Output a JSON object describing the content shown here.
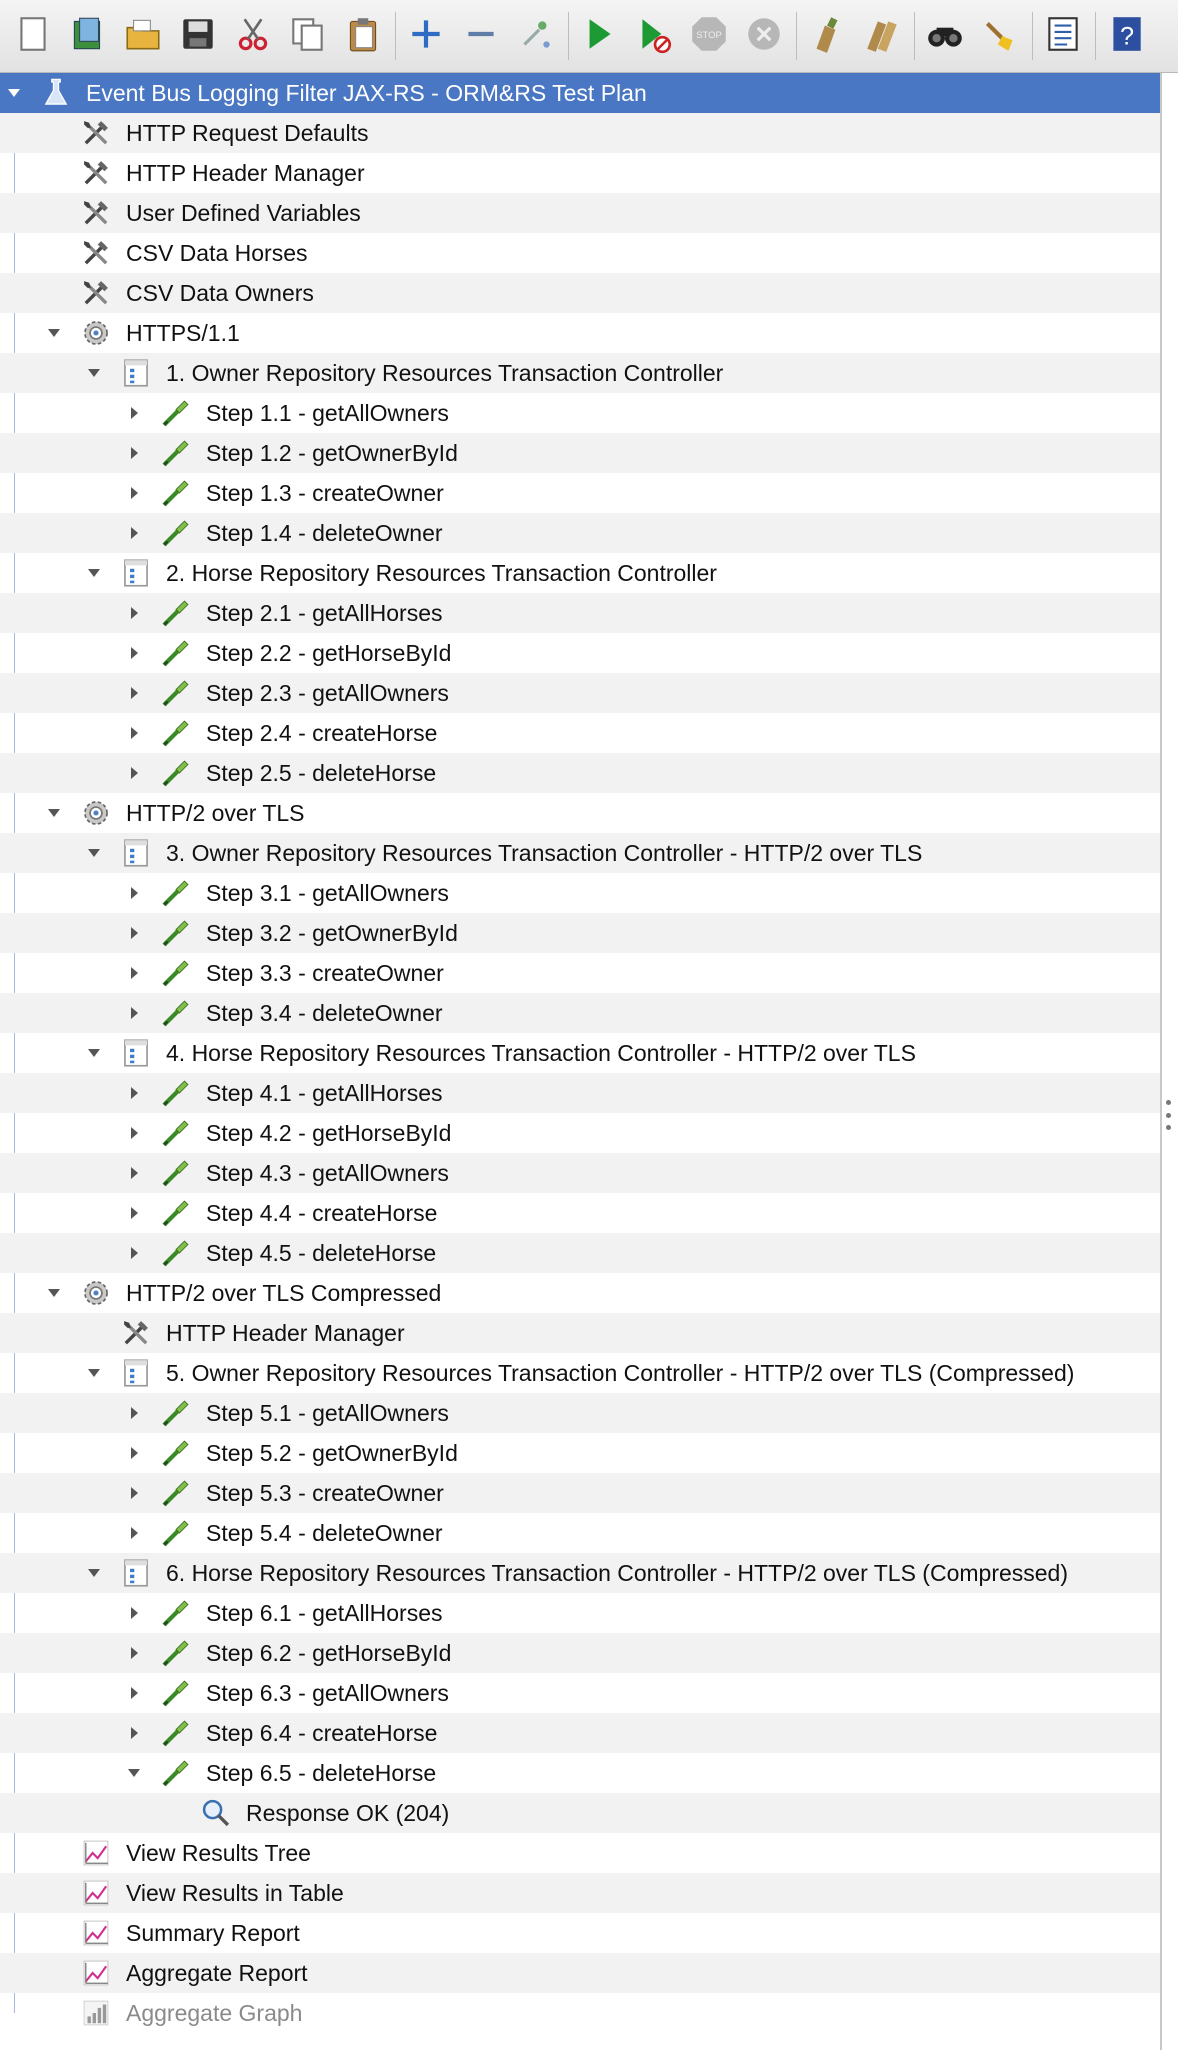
{
  "toolbar": {
    "buttons": [
      {
        "name": "new-icon"
      },
      {
        "name": "templates-icon"
      },
      {
        "name": "open-icon"
      },
      {
        "name": "save-icon"
      },
      {
        "name": "cut-icon"
      },
      {
        "name": "copy-icon"
      },
      {
        "name": "paste-icon"
      },
      {
        "name": "expand-icon"
      },
      {
        "name": "collapse-icon"
      },
      {
        "name": "toggle-icon"
      },
      {
        "name": "start-icon"
      },
      {
        "name": "start-no-pauses-icon"
      },
      {
        "name": "stop-icon"
      },
      {
        "name": "shutdown-icon"
      },
      {
        "name": "clear-icon"
      },
      {
        "name": "clear-all-icon"
      },
      {
        "name": "search-icon"
      },
      {
        "name": "reset-search-icon"
      },
      {
        "name": "function-helper-icon"
      },
      {
        "name": "help-icon"
      }
    ]
  },
  "tree": {
    "rows": [
      {
        "label": "Event Bus Logging Filter JAX-RS - ORM&RS Test Plan",
        "level": 0,
        "icon": "test-plan-icon",
        "toggle": "expanded",
        "selected": true
      },
      {
        "label": "HTTP Request Defaults",
        "level": 1,
        "icon": "config-element-icon",
        "toggle": "none"
      },
      {
        "label": "HTTP Header Manager",
        "level": 1,
        "icon": "config-element-icon",
        "toggle": "none"
      },
      {
        "label": "User Defined Variables",
        "level": 1,
        "icon": "config-element-icon",
        "toggle": "none"
      },
      {
        "label": "CSV Data Horses",
        "level": 1,
        "icon": "config-element-icon",
        "toggle": "none"
      },
      {
        "label": "CSV Data Owners",
        "level": 1,
        "icon": "config-element-icon",
        "toggle": "none"
      },
      {
        "label": "HTTPS/1.1",
        "level": 1,
        "icon": "thread-group-icon",
        "toggle": "expanded"
      },
      {
        "label": "1. Owner Repository Resources Transaction Controller",
        "level": 2,
        "icon": "transaction-controller-icon",
        "toggle": "expanded"
      },
      {
        "label": "Step 1.1 - getAllOwners",
        "level": 3,
        "icon": "sampler-icon",
        "toggle": "collapsed"
      },
      {
        "label": "Step 1.2 - getOwnerById",
        "level": 3,
        "icon": "sampler-icon",
        "toggle": "collapsed"
      },
      {
        "label": "Step 1.3 - createOwner",
        "level": 3,
        "icon": "sampler-icon",
        "toggle": "collapsed"
      },
      {
        "label": "Step 1.4 - deleteOwner",
        "level": 3,
        "icon": "sampler-icon",
        "toggle": "collapsed"
      },
      {
        "label": "2. Horse Repository Resources Transaction Controller",
        "level": 2,
        "icon": "transaction-controller-icon",
        "toggle": "expanded"
      },
      {
        "label": "Step 2.1 - getAllHorses",
        "level": 3,
        "icon": "sampler-icon",
        "toggle": "collapsed"
      },
      {
        "label": "Step 2.2 - getHorseById",
        "level": 3,
        "icon": "sampler-icon",
        "toggle": "collapsed"
      },
      {
        "label": "Step 2.3 - getAllOwners",
        "level": 3,
        "icon": "sampler-icon",
        "toggle": "collapsed"
      },
      {
        "label": "Step 2.4 - createHorse",
        "level": 3,
        "icon": "sampler-icon",
        "toggle": "collapsed"
      },
      {
        "label": "Step 2.5 - deleteHorse",
        "level": 3,
        "icon": "sampler-icon",
        "toggle": "collapsed"
      },
      {
        "label": "HTTP/2 over TLS",
        "level": 1,
        "icon": "thread-group-icon",
        "toggle": "expanded"
      },
      {
        "label": "3. Owner Repository Resources Transaction Controller - HTTP/2 over TLS",
        "level": 2,
        "icon": "transaction-controller-icon",
        "toggle": "expanded"
      },
      {
        "label": "Step 3.1 - getAllOwners",
        "level": 3,
        "icon": "sampler-icon",
        "toggle": "collapsed"
      },
      {
        "label": "Step 3.2 - getOwnerById",
        "level": 3,
        "icon": "sampler-icon",
        "toggle": "collapsed"
      },
      {
        "label": "Step 3.3 - createOwner",
        "level": 3,
        "icon": "sampler-icon",
        "toggle": "collapsed"
      },
      {
        "label": "Step 3.4 - deleteOwner",
        "level": 3,
        "icon": "sampler-icon",
        "toggle": "collapsed"
      },
      {
        "label": "4. Horse Repository Resources Transaction Controller - HTTP/2 over TLS",
        "level": 2,
        "icon": "transaction-controller-icon",
        "toggle": "expanded"
      },
      {
        "label": "Step 4.1 - getAllHorses",
        "level": 3,
        "icon": "sampler-icon",
        "toggle": "collapsed"
      },
      {
        "label": "Step 4.2 - getHorseById",
        "level": 3,
        "icon": "sampler-icon",
        "toggle": "collapsed"
      },
      {
        "label": "Step 4.3 - getAllOwners",
        "level": 3,
        "icon": "sampler-icon",
        "toggle": "collapsed"
      },
      {
        "label": "Step 4.4 - createHorse",
        "level": 3,
        "icon": "sampler-icon",
        "toggle": "collapsed"
      },
      {
        "label": "Step 4.5 - deleteHorse",
        "level": 3,
        "icon": "sampler-icon",
        "toggle": "collapsed"
      },
      {
        "label": "HTTP/2 over TLS Compressed",
        "level": 1,
        "icon": "thread-group-icon",
        "toggle": "expanded"
      },
      {
        "label": "HTTP Header Manager",
        "level": 2,
        "icon": "config-element-icon",
        "toggle": "none"
      },
      {
        "label": "5. Owner Repository Resources Transaction Controller - HTTP/2 over TLS (Compressed)",
        "level": 2,
        "icon": "transaction-controller-icon",
        "toggle": "expanded"
      },
      {
        "label": "Step 5.1 - getAllOwners",
        "level": 3,
        "icon": "sampler-icon",
        "toggle": "collapsed"
      },
      {
        "label": "Step 5.2 - getOwnerById",
        "level": 3,
        "icon": "sampler-icon",
        "toggle": "collapsed"
      },
      {
        "label": "Step 5.3 - createOwner",
        "level": 3,
        "icon": "sampler-icon",
        "toggle": "collapsed"
      },
      {
        "label": "Step 5.4 - deleteOwner",
        "level": 3,
        "icon": "sampler-icon",
        "toggle": "collapsed"
      },
      {
        "label": "6. Horse Repository Resources Transaction Controller - HTTP/2 over TLS (Compressed)",
        "level": 2,
        "icon": "transaction-controller-icon",
        "toggle": "expanded"
      },
      {
        "label": "Step 6.1 - getAllHorses",
        "level": 3,
        "icon": "sampler-icon",
        "toggle": "collapsed"
      },
      {
        "label": "Step 6.2 - getHorseById",
        "level": 3,
        "icon": "sampler-icon",
        "toggle": "collapsed"
      },
      {
        "label": "Step 6.3 - getAllOwners",
        "level": 3,
        "icon": "sampler-icon",
        "toggle": "collapsed"
      },
      {
        "label": "Step 6.4 - createHorse",
        "level": 3,
        "icon": "sampler-icon",
        "toggle": "collapsed"
      },
      {
        "label": "Step 6.5 - deleteHorse",
        "level": 3,
        "icon": "sampler-icon",
        "toggle": "expanded"
      },
      {
        "label": "Response OK (204)",
        "level": 4,
        "icon": "assertion-icon",
        "toggle": "none"
      },
      {
        "label": "View Results Tree",
        "level": 1,
        "icon": "listener-icon",
        "toggle": "none"
      },
      {
        "label": "View Results in Table",
        "level": 1,
        "icon": "listener-icon",
        "toggle": "none"
      },
      {
        "label": "Summary Report",
        "level": 1,
        "icon": "listener-icon",
        "toggle": "none"
      },
      {
        "label": "Aggregate Report",
        "level": 1,
        "icon": "listener-icon",
        "toggle": "none"
      },
      {
        "label": "Aggregate Graph",
        "level": 1,
        "icon": "listener-icon",
        "toggle": "none",
        "disabled": true
      }
    ]
  }
}
